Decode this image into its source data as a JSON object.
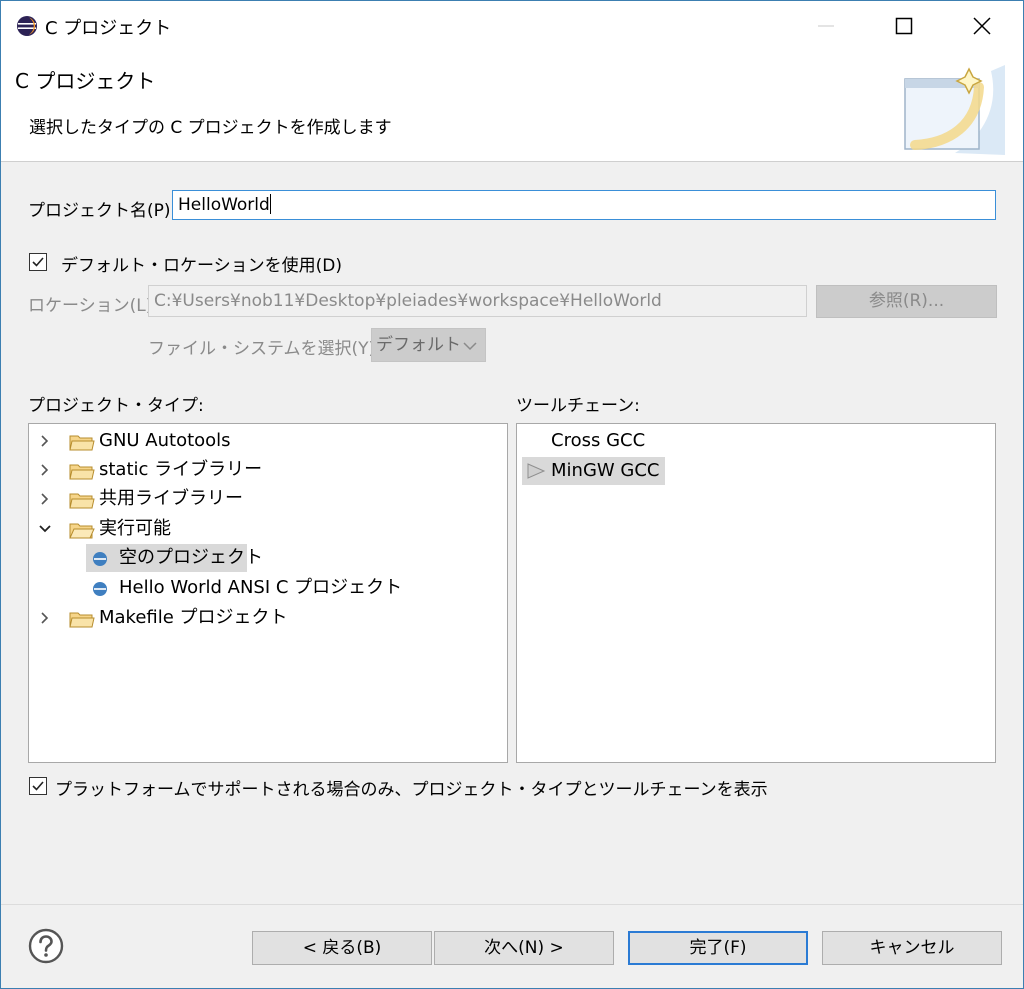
{
  "window": {
    "title": "C プロジェクト"
  },
  "header": {
    "title": "C プロジェクト",
    "description": "選択したタイプの C プロジェクトを作成します"
  },
  "form": {
    "project_name_label": "プロジェクト名(P):",
    "project_name_value": "HelloWorld",
    "default_location_label": "デフォルト・ロケーションを使用(D)",
    "default_location_checked": true,
    "location_label": "ロケーション(L):",
    "location_value": "C:¥Users¥nob11¥Desktop¥pleiades¥workspace¥HelloWorld",
    "browse_label": "参照(R)...",
    "filesystem_label": "ファイル・システムを選択(Y):",
    "filesystem_value": "デフォルト"
  },
  "project_types": {
    "label": "プロジェクト・タイプ:",
    "items": [
      {
        "label": "GNU Autotools",
        "expanded": false
      },
      {
        "label": "static ライブラリー",
        "expanded": false
      },
      {
        "label": "共用ライブラリー",
        "expanded": false
      },
      {
        "label": "実行可能",
        "expanded": true
      },
      {
        "label": "空のプロジェクト",
        "child": true,
        "selected": true
      },
      {
        "label": "Hello World ANSI C プロジェクト",
        "child": true
      },
      {
        "label": "Makefile プロジェクト",
        "expanded": false
      }
    ]
  },
  "toolchains": {
    "label": "ツールチェーン:",
    "items": [
      {
        "label": "Cross GCC"
      },
      {
        "label": "MinGW GCC",
        "selected": true
      }
    ]
  },
  "platform_filter": {
    "label": "プラットフォームでサポートされる場合のみ、プロジェクト・タイプとツールチェーンを表示",
    "checked": true
  },
  "buttons": {
    "back": "< 戻る(B)",
    "next": "次へ(N) >",
    "finish": "完了(F)",
    "cancel": "キャンセル"
  },
  "icons": {
    "app": "eclipse-icon",
    "help": "help-icon",
    "folder": "folder-icon",
    "bullet": "project-bullet-icon",
    "banner": "wizard-banner-icon"
  },
  "colors": {
    "accent": "#2b7bd4",
    "selection": "#d9d9d9",
    "disabled_text": "#8a8a8a"
  }
}
